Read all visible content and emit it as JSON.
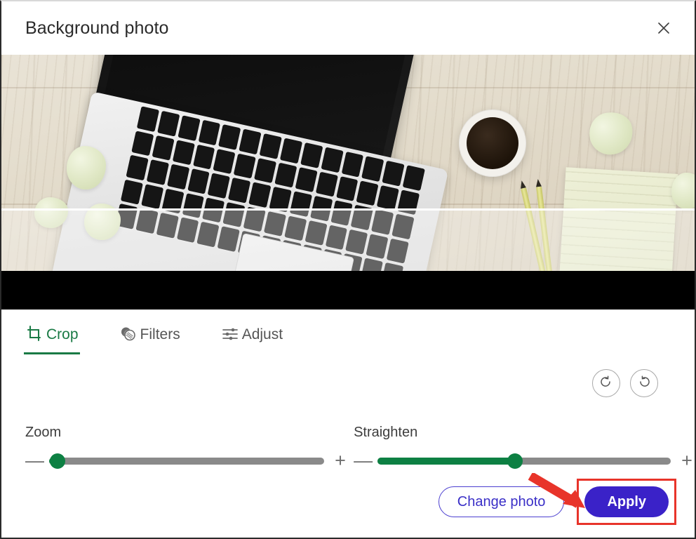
{
  "dialog": {
    "title": "Background photo",
    "close_icon": "close-icon"
  },
  "photo": {
    "alt": "Top-down photo of a silver laptop on a light wooden desk with a cup of black coffee, two yellow pencils, a pale green sticky note and crumpled paper scraps",
    "crop_guide_visible": true,
    "letterbox_color": "#000000"
  },
  "toolbar": {
    "tabs": [
      {
        "label": "Crop",
        "icon": "crop-icon",
        "active": true
      },
      {
        "label": "Filters",
        "icon": "filters-icon",
        "active": false
      },
      {
        "label": "Adjust",
        "icon": "adjust-icon",
        "active": false
      }
    ],
    "active_color": "#1a7a45",
    "inactive_color": "#555555"
  },
  "rotate": {
    "clockwise_icon": "rotate-clockwise-icon",
    "counterclockwise_icon": "rotate-counterclockwise-icon"
  },
  "sliders": [
    {
      "name": "zoom",
      "label": "Zoom",
      "minus_label": "—",
      "plus_label": "+",
      "value_percent": 3,
      "fill_color": "#0d8043",
      "track_color": "#8a8a8a"
    },
    {
      "name": "straighten",
      "label": "Straighten",
      "minus_label": "—",
      "plus_label": "+",
      "value_percent": 47,
      "fill_color": "#0d8043",
      "track_color": "#8a8a8a"
    }
  ],
  "footer": {
    "change_photo_label": "Change photo",
    "apply_label": "Apply",
    "apply_color": "#3a22c8",
    "change_photo_border_color": "#4b3fd0"
  },
  "annotation": {
    "highlight_color": "#e8342a",
    "arrow_icon": "red-arrow-icon",
    "target": "apply-button"
  }
}
